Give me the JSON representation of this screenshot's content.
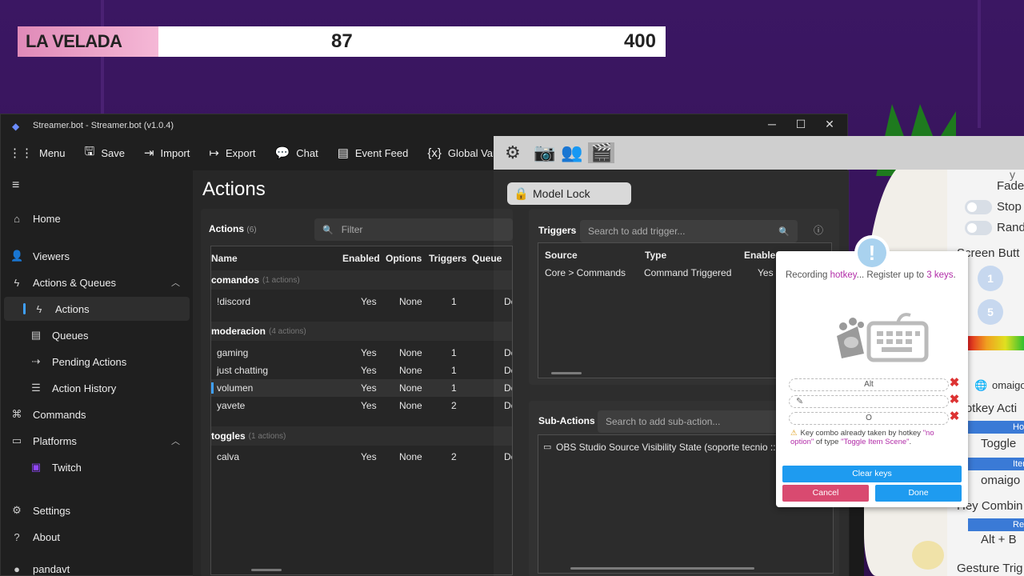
{
  "overlay": {
    "tag": "LA VELADA",
    "current": "87",
    "goal": "400"
  },
  "window": {
    "title": "Streamer.bot - Streamer.bot (v1.0.4)",
    "controls": [
      "─",
      "☐",
      "✕"
    ]
  },
  "toolbar": [
    {
      "icon": "menu-grid-icon",
      "glyph": "⋮⋮",
      "label": "Menu"
    },
    {
      "icon": "save-icon",
      "glyph": "🖫",
      "label": "Save"
    },
    {
      "icon": "import-icon",
      "glyph": "⇥",
      "label": "Import"
    },
    {
      "icon": "export-icon",
      "glyph": "↦",
      "label": "Export"
    },
    {
      "icon": "chat-icon",
      "glyph": "💬",
      "label": "Chat"
    },
    {
      "icon": "event-feed-icon",
      "glyph": "▤",
      "label": "Event Feed"
    },
    {
      "icon": "variables-icon",
      "glyph": "{x}",
      "label": "Global Variables"
    }
  ],
  "sidebar": {
    "items": [
      {
        "label": "Home",
        "icon": "home-icon",
        "glyph": "⌂"
      },
      {
        "label": "Viewers",
        "icon": "user-icon",
        "glyph": "👤"
      },
      {
        "label": "Actions & Queues",
        "icon": "bolt-icon",
        "glyph": "ϟ"
      },
      {
        "label": "Actions",
        "icon": "bolt-icon",
        "glyph": "ϟ"
      },
      {
        "label": "Queues",
        "icon": "queue-icon",
        "glyph": "▤"
      },
      {
        "label": "Pending Actions",
        "icon": "pending-icon",
        "glyph": "⇢"
      },
      {
        "label": "Action History",
        "icon": "history-icon",
        "glyph": "☰"
      },
      {
        "label": "Commands",
        "icon": "command-icon",
        "glyph": "⌘"
      },
      {
        "label": "Platforms",
        "icon": "platforms-icon",
        "glyph": "▭"
      },
      {
        "label": "Twitch",
        "icon": "twitch-icon",
        "glyph": "▣"
      },
      {
        "label": "Settings",
        "icon": "gear-icon",
        "glyph": "⚙"
      },
      {
        "label": "About",
        "icon": "question-icon",
        "glyph": "?"
      },
      {
        "label": "pandavt",
        "icon": "avatar",
        "glyph": ""
      }
    ]
  },
  "main": {
    "title": "Actions",
    "actions_panel": {
      "title": "Actions",
      "count": "(6)",
      "filter_placeholder": "Filter",
      "columns": [
        "Name",
        "Enabled",
        "Options",
        "Triggers",
        "Queue"
      ],
      "groups": [
        {
          "name": "comandos",
          "count": "(1 actions)",
          "rows": [
            {
              "name": "!discord",
              "enabled": "Yes",
              "options": "None",
              "triggers": "1",
              "queue": "De"
            }
          ]
        },
        {
          "name": "moderacion",
          "count": "(4 actions)",
          "rows": [
            {
              "name": "gaming",
              "enabled": "Yes",
              "options": "None",
              "triggers": "1",
              "queue": "De"
            },
            {
              "name": "just chatting",
              "enabled": "Yes",
              "options": "None",
              "triggers": "1",
              "queue": "De"
            },
            {
              "name": "volumen",
              "enabled": "Yes",
              "options": "None",
              "triggers": "1",
              "queue": "De"
            },
            {
              "name": "yavete",
              "enabled": "Yes",
              "options": "None",
              "triggers": "2",
              "queue": "De"
            }
          ]
        },
        {
          "name": "toggles",
          "count": "(1 actions)",
          "rows": [
            {
              "name": "calva",
              "enabled": "Yes",
              "options": "None",
              "triggers": "2",
              "queue": "De"
            }
          ]
        }
      ]
    },
    "triggers_panel": {
      "title": "Triggers",
      "search_placeholder": "Search to add trigger...",
      "columns": [
        "Source",
        "Type",
        "Enabled"
      ],
      "rows": [
        {
          "source": "Core > Commands",
          "type": "Command Triggered",
          "enabled": "Yes"
        }
      ]
    },
    "subactions_panel": {
      "title": "Sub-Actions",
      "search_placeholder": "Search to add sub-action...",
      "rows": [
        "OBS Studio Source Visibility State (soporte tecnio :: microfo"
      ]
    }
  },
  "obs": {
    "model_lock": "Model Lock"
  },
  "right_panel": {
    "labels": [
      "Fade",
      "Stop",
      "Rand",
      "Screen Butt",
      "omaigo",
      "Hotkey Acti",
      "Hotke",
      "Toggle",
      "Item",
      "omaigo",
      "Hey Combin",
      "Re",
      "Alt + B",
      "Gesture Trig"
    ],
    "circles": [
      "1",
      "5"
    ]
  },
  "dialog": {
    "rec_prefix": "Recording ",
    "rec_hotkey": "hotkey",
    "rec_mid": "... Register up to ",
    "rec_keys": "3 keys",
    "rec_suffix": ".",
    "keys": [
      "Alt",
      "",
      "O"
    ],
    "warn_prefix": "Key combo already taken by hotkey ",
    "warn_name": "\"no option\"",
    "warn_mid": " of type ",
    "warn_type": "\"Toggle Item Scene\"",
    "warn_suffix": ".",
    "clear_label": "Clear keys",
    "cancel_label": "Cancel",
    "done_label": "Done"
  }
}
